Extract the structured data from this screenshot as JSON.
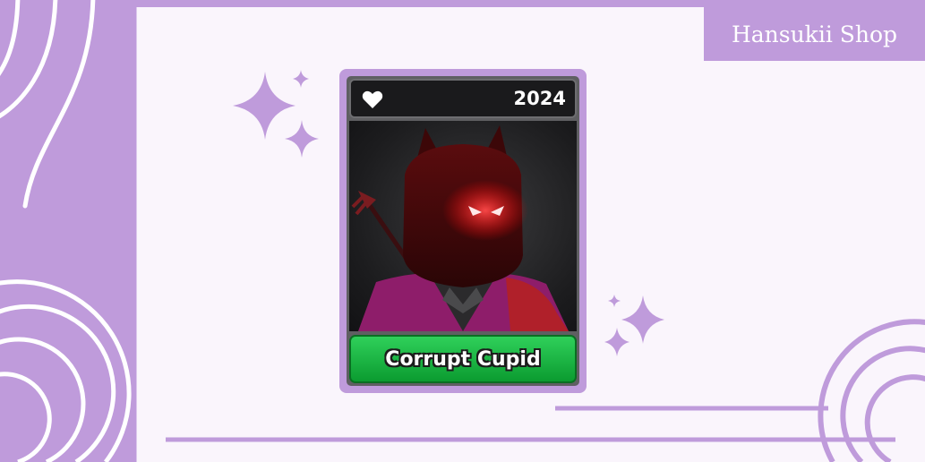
{
  "shop": {
    "name": "Hansukii Shop"
  },
  "card": {
    "year": "2024",
    "item_name": "Corrupt Cupid",
    "icon": "heart-icon",
    "image_subject": "red-devil-avatar-icon"
  },
  "colors": {
    "accent": "#bf9bdb",
    "background": "#faf5fc",
    "name_bar": "#16b840",
    "card_frame": "#5f5f62"
  }
}
